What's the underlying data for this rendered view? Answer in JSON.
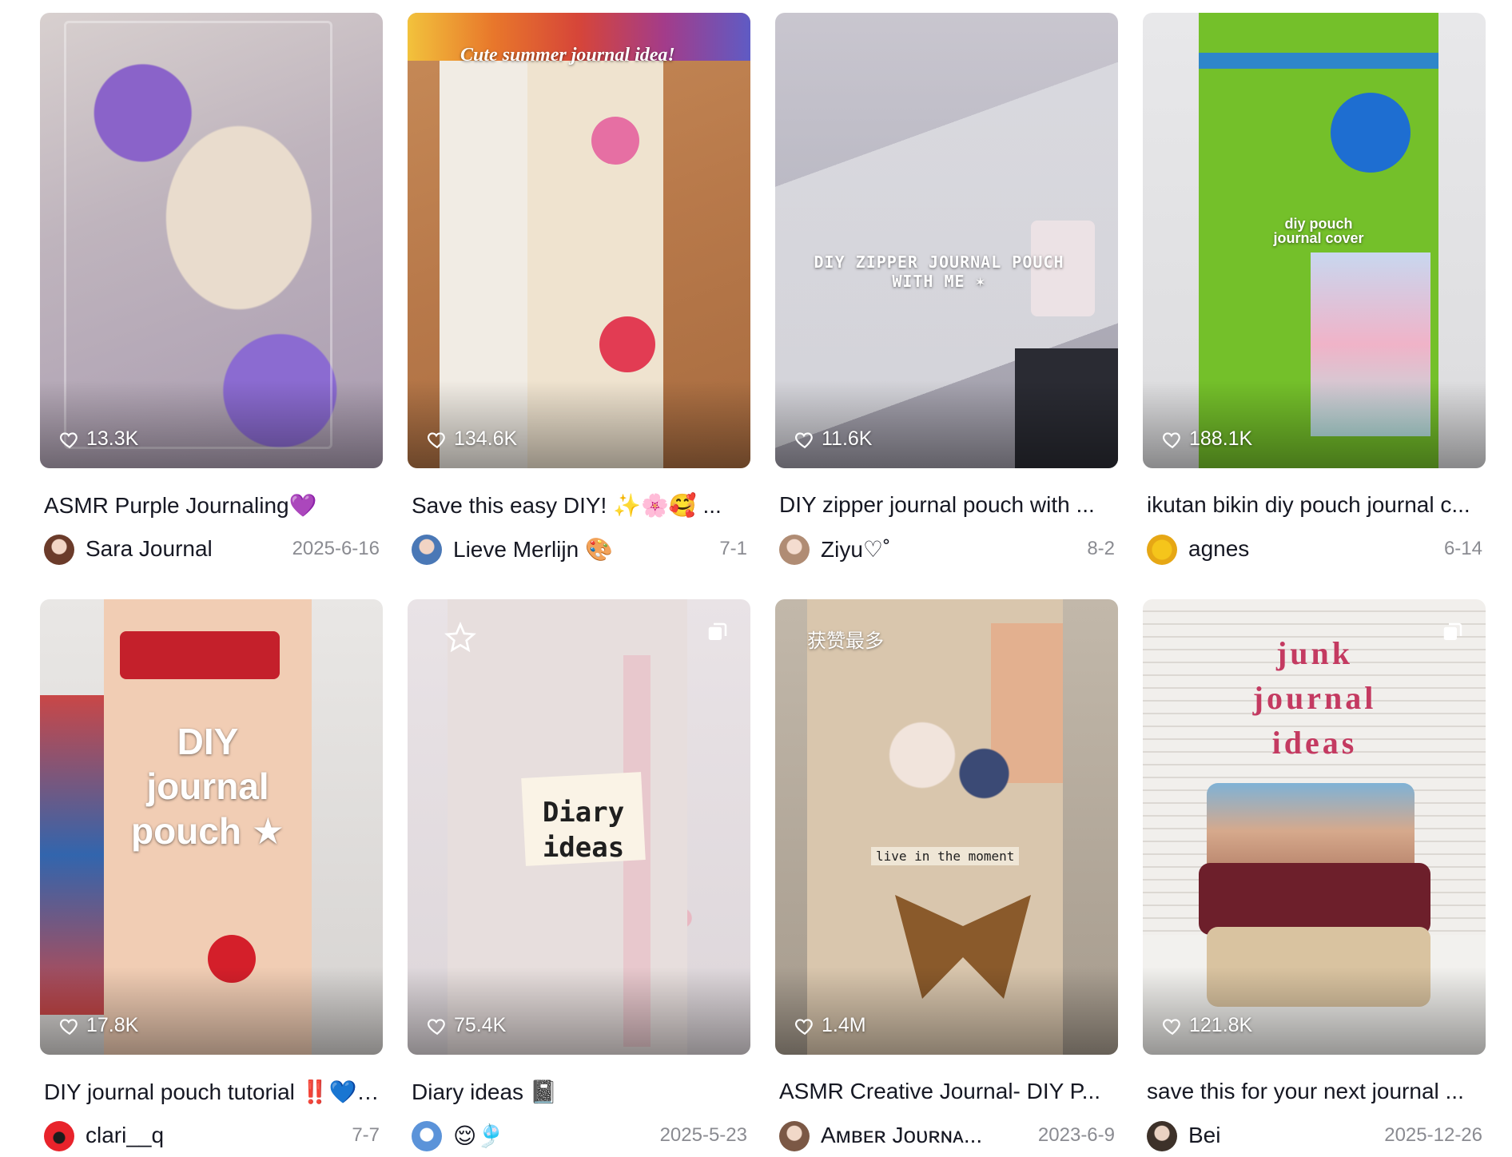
{
  "cards": [
    {
      "likes": "13.3K",
      "title": "ASMR Purple Journaling💜",
      "author": "Sara Journal",
      "date": "2025-6-16",
      "overlay": ""
    },
    {
      "likes": "134.6K",
      "title": "Save this easy DIY! ✨🌸🥰 ...",
      "author": "Lieve Merlijn 🎨",
      "date": "7-1",
      "overlay": "Cute summer journal idea!"
    },
    {
      "likes": "11.6K",
      "title": "DIY zipper journal pouch with ...",
      "author": "Ziyu♡˚",
      "date": "8-2",
      "overlay": "DIY ZIPPER JOURNAL POUCH WITH ME ✶"
    },
    {
      "likes": "188.1K",
      "title": "ikutan bikin diy pouch journal c...",
      "author": "agnes",
      "date": "6-14",
      "overlay": "diy pouch journal cover"
    },
    {
      "likes": "17.8K",
      "title": "DIY journal pouch tutorial ‼️💙🌟",
      "author": "clari__q",
      "date": "7-7",
      "overlay": "DIY journal pouch ★"
    },
    {
      "likes": "75.4K",
      "title": "Diary ideas 📓",
      "author": "😌🎐",
      "date": "2025-5-23",
      "overlay": "Diary ideas"
    },
    {
      "likes": "1.4M",
      "title": "ASMR Creative Journal- DIY P...",
      "author": "Aᴍʙᴇʀ Jᴏᴜʀɴᴀ...",
      "date": "2023-6-9",
      "overlay": "live in the moment",
      "badge": "获赞最多"
    },
    {
      "likes": "121.8K",
      "title": "save this for your next journal ...",
      "author": "Bei",
      "date": "2025-12-26",
      "overlay": "junk journal ideas"
    }
  ],
  "colors": {
    "text": "#161823",
    "muted": "#8a8b91",
    "background": "#ffffff"
  }
}
